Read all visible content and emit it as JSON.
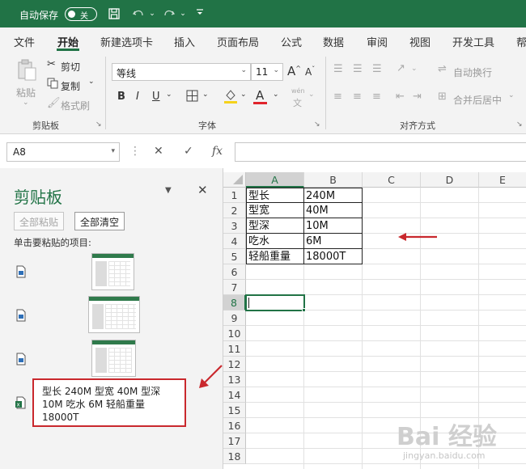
{
  "titlebar": {
    "autosave_label": "自动保存",
    "toggle_state": "关",
    "accent": "#217346"
  },
  "tabs": [
    "文件",
    "开始",
    "新建选项卡",
    "插入",
    "页面布局",
    "公式",
    "数据",
    "审阅",
    "视图",
    "开发工具",
    "帮"
  ],
  "active_tab": "开始",
  "ribbon": {
    "clipboard": {
      "paste": "粘贴",
      "cut": "剪切",
      "copy": "复制",
      "format_painter": "格式刷",
      "group_label": "剪贴板"
    },
    "font": {
      "font_name": "等线",
      "font_size": "11",
      "grow": "A",
      "shrink": "A",
      "bold": "B",
      "italic": "I",
      "underline": "U",
      "font_color_letter": "A",
      "wen": "wén",
      "group_label": "字体"
    },
    "alignment": {
      "wrap_text": "自动换行",
      "merge_center": "合并后居中",
      "group_label": "对齐方式"
    }
  },
  "formula_bar": {
    "name_box": "A8",
    "fx": "fx",
    "cancel": "✕",
    "enter": "✓",
    "formula": ""
  },
  "clipboard_pane": {
    "title": "剪贴板",
    "paste_all": "全部粘贴",
    "clear_all": "全部清空",
    "hint": "单击要粘贴的项目:",
    "item_text": [
      "型长 240M 型宽 40M 型深",
      "10M 吃水 6M 轻船重量",
      "18000T"
    ]
  },
  "sheet": {
    "columns": [
      "A",
      "B",
      "C",
      "D",
      "E"
    ],
    "rows": [
      "1",
      "2",
      "3",
      "4",
      "5",
      "6",
      "7",
      "8",
      "9",
      "10",
      "11",
      "12",
      "13",
      "14",
      "15",
      "16",
      "17",
      "18"
    ],
    "selected_cell": "A8",
    "cells": [
      [
        "型长",
        "240M"
      ],
      [
        "型宽",
        "40M"
      ],
      [
        "型深",
        "10M"
      ],
      [
        "吃水",
        "6M"
      ],
      [
        "轻船重量",
        "18000T"
      ]
    ]
  },
  "annotation_color": "#c9282d",
  "watermark": {
    "text": "Bai 经验",
    "sub": "jingyan.baidu.com"
  }
}
